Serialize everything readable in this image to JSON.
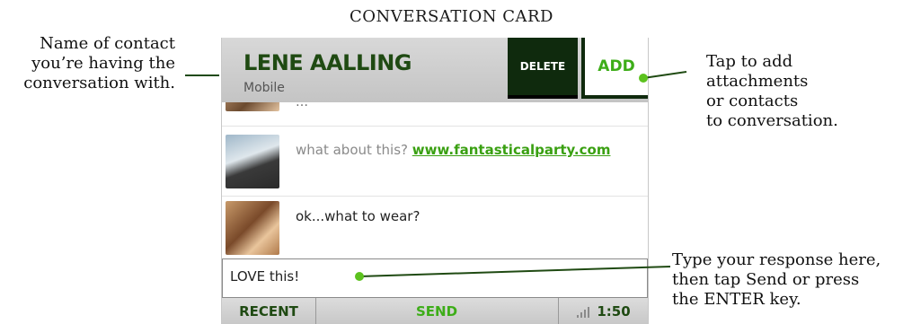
{
  "title": "CONVERSATION CARD",
  "annotations": {
    "contact_name": [
      "Name of contact",
      "you’re having the",
      "conversation with."
    ],
    "add": [
      "Tap to add",
      "attachments",
      "or contacts",
      "to conversation."
    ],
    "reply": [
      "Type your response here,",
      "then tap Send or press",
      "the ENTER key."
    ]
  },
  "card": {
    "contact_name": "LENE AALLING",
    "contact_subtitle": "Mobile",
    "delete_label": "DELETE",
    "add_label": "ADD",
    "messages": {
      "previous_partial": "…",
      "msg2_text": "what about this?",
      "msg2_link": "www.fantasticalparty.com",
      "msg3_text": "ok...what to wear?"
    },
    "reply_value": "LOVE this!",
    "recent_label": "RECENT",
    "send_label": "SEND",
    "time": "1:50"
  },
  "colors": {
    "accent_green": "#3dad18",
    "dark_green": "#0f2a0d",
    "callout_line": "#1f4a12",
    "callout_dot": "#5cc21e"
  },
  "icons": {
    "signal": "signal-strength-icon"
  }
}
